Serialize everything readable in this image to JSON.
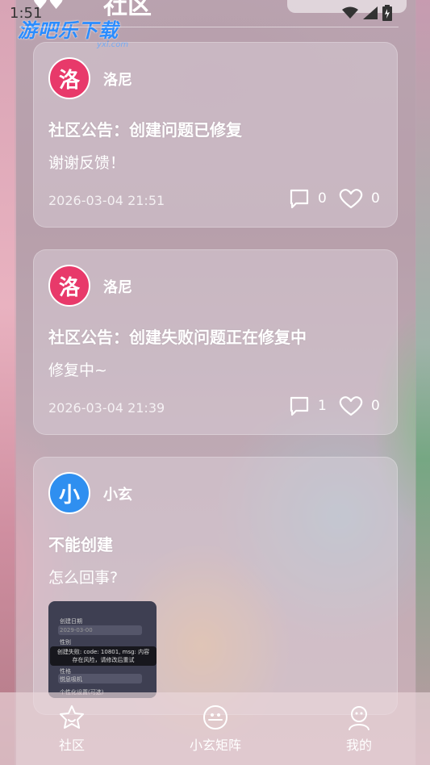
{
  "status_bar": {
    "time": "1:51"
  },
  "watermark": {
    "text": "游吧乐下载",
    "sub": "yxl.com"
  },
  "header": {
    "title": "社区"
  },
  "posts": [
    {
      "avatar_char": "洛",
      "author": "洛尼",
      "title": "社区公告：创建问题已修复",
      "body": "谢谢反馈！",
      "time": "2026-03-04 21:51",
      "comments": "0",
      "likes": "0"
    },
    {
      "avatar_char": "洛",
      "author": "洛尼",
      "title": "社区公告：创建失败问题正在修复中",
      "body": "修复中~",
      "time": "2026-03-04 21:39",
      "comments": "1",
      "likes": "0"
    },
    {
      "avatar_char": "小",
      "author": "小玄",
      "title": "不能创建",
      "body": "怎么回事?",
      "image": {
        "field1": "创建日期",
        "field1_value": "2029-03-00",
        "field2": "性别",
        "field2_value": "男",
        "field3": "性格",
        "field3_value": "悦息吸机",
        "field4": "个性化设置(可选)",
        "toast": "创建失败: code: 10801, msg: 内容存在风险，请修改后重试"
      }
    }
  ],
  "nav": {
    "community": "社区",
    "matrix": "小玄矩阵",
    "mine": "我的"
  },
  "colors": {
    "avatar_pink": "#e8396a",
    "avatar_blue": "#2f8ff0",
    "accent_watermark": "#2a8cff"
  },
  "icons": [
    "comment-icon",
    "heart-icon",
    "star-icon",
    "chat-bubble-icon",
    "profile-icon",
    "wifi-icon",
    "signal-icon",
    "battery-icon"
  ]
}
